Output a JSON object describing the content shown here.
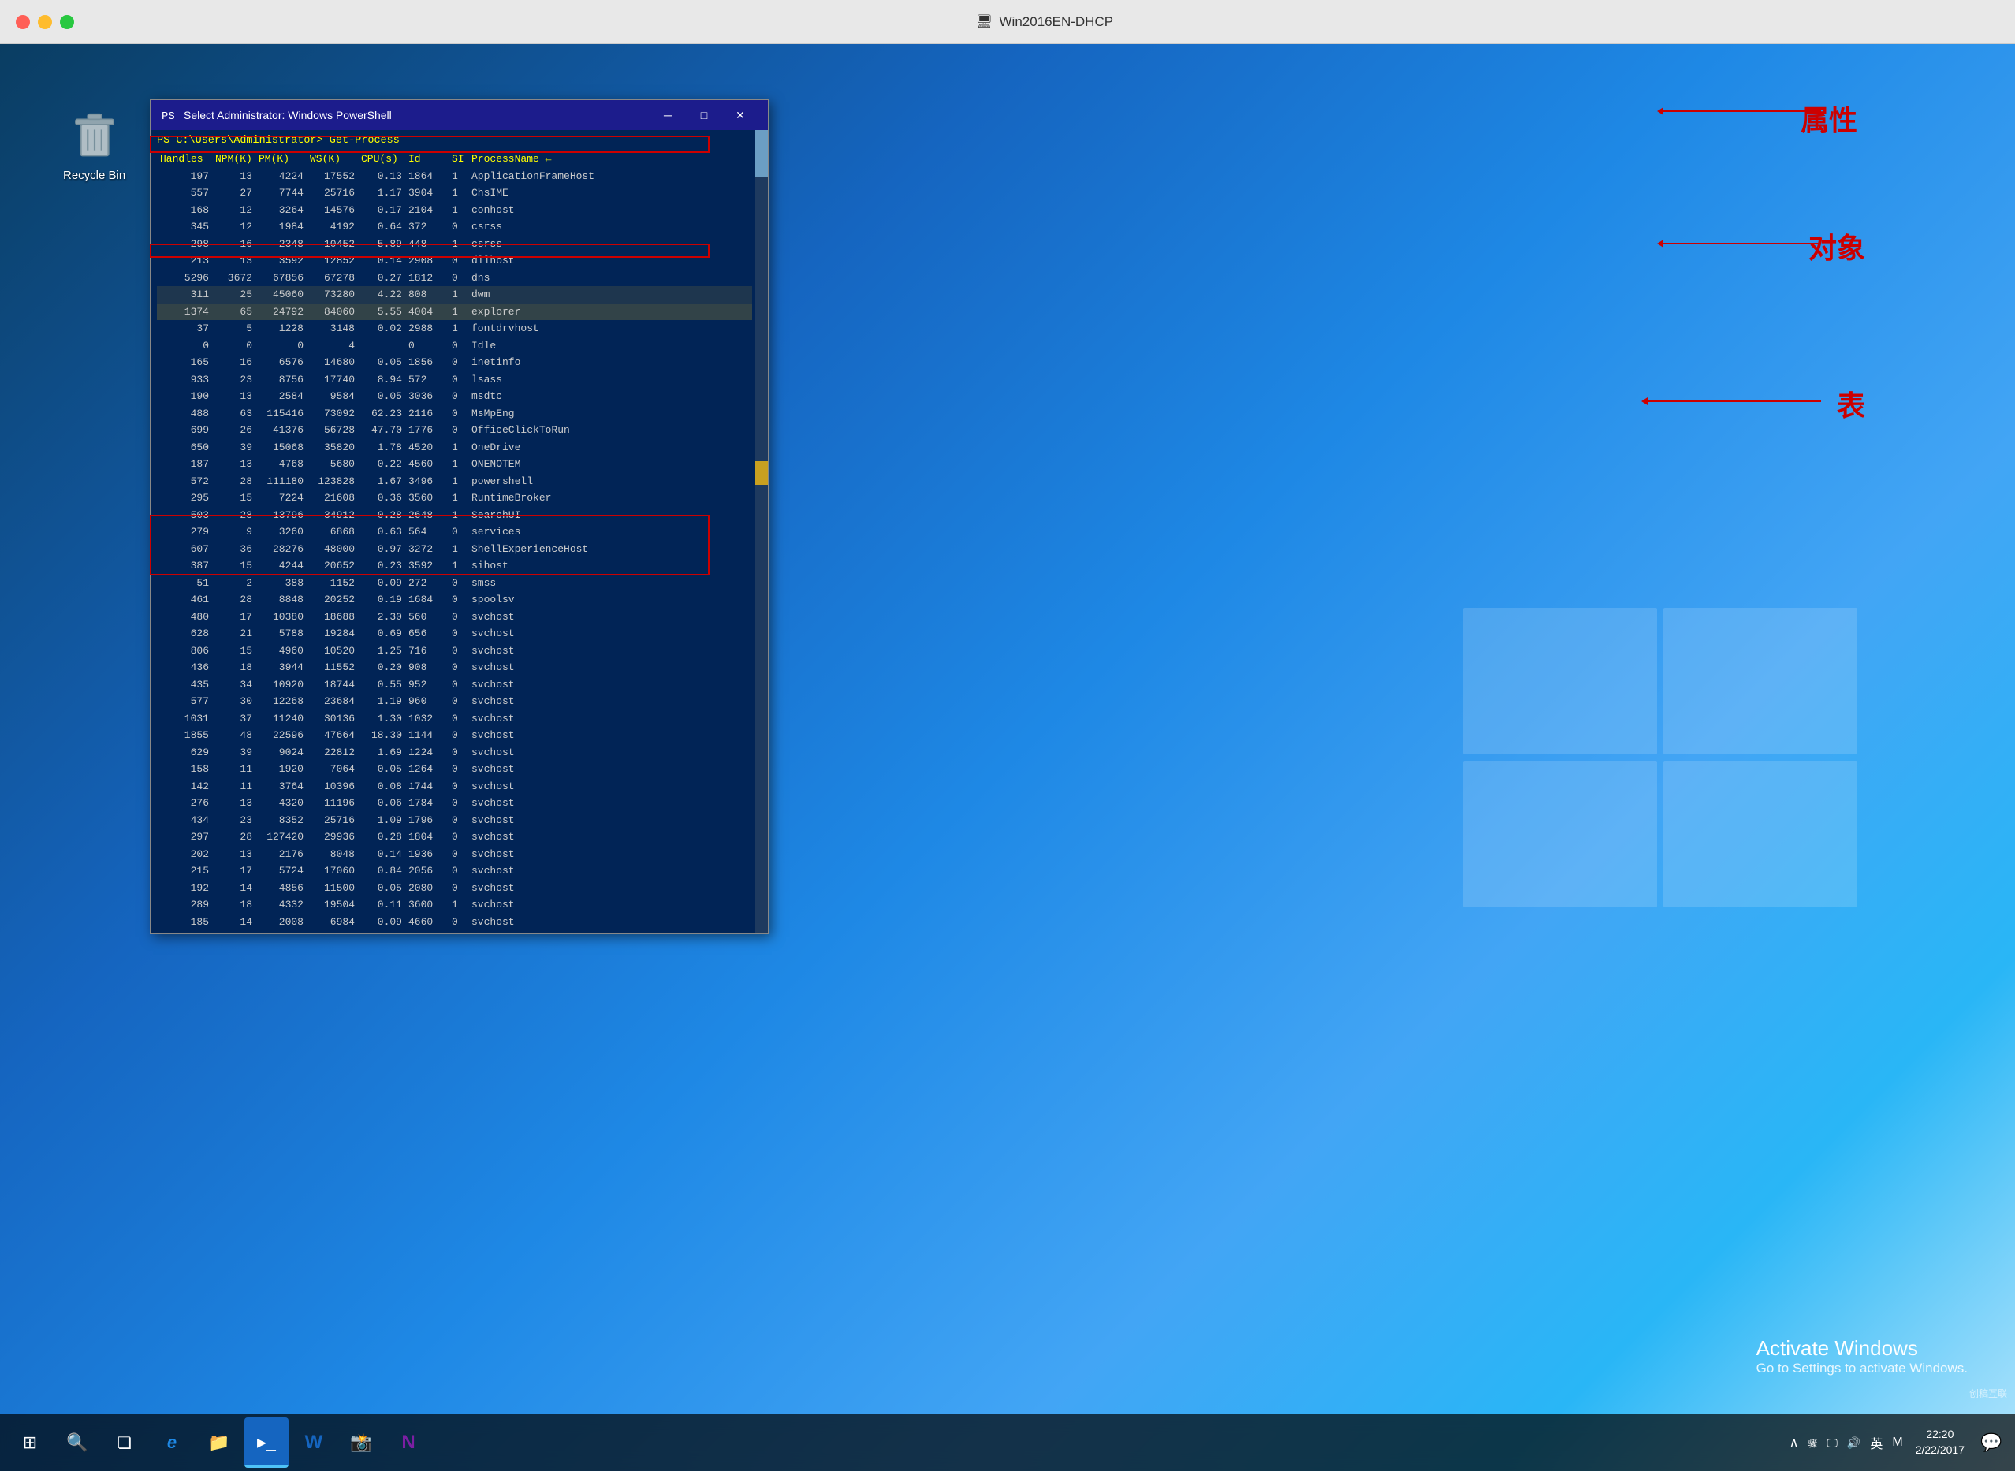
{
  "window": {
    "title": "Win2016EN-DHCP",
    "icon": "🖥"
  },
  "desktop": {
    "recycle_bin_label": "Recycle Bin"
  },
  "powershell": {
    "title": "Select Administrator: Windows PowerShell",
    "prompt": "PS C:\\Users\\Administrator> Get-Process",
    "columns": [
      "Handles",
      "NPM(K)",
      "PM(K)",
      "WS(K)",
      "CPU(s)",
      "Id",
      "SI",
      "ProcessName"
    ],
    "column_widths": [
      "70px",
      "55px",
      "70px",
      "70px",
      "60px",
      "55px",
      "30px",
      "150px"
    ],
    "processes": [
      [
        "197",
        "13",
        "4224",
        "17552",
        "0.13",
        "1864",
        "1",
        "ApplicationFrameHost"
      ],
      [
        "557",
        "27",
        "7744",
        "25716",
        "1.17",
        "3904",
        "1",
        "ChsIME"
      ],
      [
        "168",
        "12",
        "3264",
        "14576",
        "0.17",
        "2104",
        "1",
        "conhost"
      ],
      [
        "345",
        "12",
        "1984",
        "4192",
        "0.64",
        "372",
        "0",
        "csrss"
      ],
      [
        "298",
        "16",
        "2348",
        "10452",
        "5.89",
        "448",
        "1",
        "csrss"
      ],
      [
        "213",
        "13",
        "3592",
        "12852",
        "0.14",
        "2908",
        "0",
        "dllhost"
      ],
      [
        "5296",
        "3672",
        "67856",
        "67278",
        "0.27",
        "1812",
        "0",
        "dns"
      ],
      [
        "311",
        "25",
        "45060",
        "73280",
        "4.22",
        "808",
        "1",
        "dwm"
      ],
      [
        "1374",
        "65",
        "24792",
        "84060",
        "5.55",
        "4004",
        "1",
        "explorer"
      ],
      [
        "37",
        "5",
        "1228",
        "3148",
        "0.02",
        "2988",
        "1",
        "fontdrvhost"
      ],
      [
        "0",
        "0",
        "0",
        "4",
        "",
        "0",
        "0",
        "Idle"
      ],
      [
        "165",
        "16",
        "6576",
        "14680",
        "0.05",
        "1856",
        "0",
        "inetinfo"
      ],
      [
        "933",
        "23",
        "8756",
        "17740",
        "8.94",
        "572",
        "0",
        "lsass"
      ],
      [
        "190",
        "13",
        "2584",
        "9584",
        "0.05",
        "3036",
        "0",
        "msdtc"
      ],
      [
        "488",
        "63",
        "115416",
        "73092",
        "62.23",
        "2116",
        "0",
        "MsMpEng"
      ],
      [
        "699",
        "26",
        "41376",
        "56728",
        "47.70",
        "1776",
        "0",
        "OfficeClickToRun"
      ],
      [
        "650",
        "39",
        "15068",
        "35820",
        "1.78",
        "4520",
        "1",
        "OneDrive"
      ],
      [
        "187",
        "13",
        "4768",
        "5680",
        "0.22",
        "4560",
        "1",
        "ONENOTEM"
      ],
      [
        "572",
        "28",
        "111180",
        "123828",
        "1.67",
        "3496",
        "1",
        "powershell"
      ],
      [
        "295",
        "15",
        "7224",
        "21608",
        "0.36",
        "3560",
        "1",
        "RuntimeBroker"
      ],
      [
        "503",
        "28",
        "13796",
        "34912",
        "0.28",
        "2648",
        "1",
        "SearchUI"
      ],
      [
        "279",
        "9",
        "3260",
        "6868",
        "0.63",
        "564",
        "0",
        "services"
      ],
      [
        "607",
        "36",
        "28276",
        "48000",
        "0.97",
        "3272",
        "1",
        "ShellExperienceHost"
      ],
      [
        "387",
        "15",
        "4244",
        "20652",
        "0.23",
        "3592",
        "1",
        "sihost"
      ],
      [
        "51",
        "2",
        "388",
        "1152",
        "0.09",
        "272",
        "0",
        "smss"
      ],
      [
        "461",
        "28",
        "8848",
        "20252",
        "0.19",
        "1684",
        "0",
        "spoolsv"
      ],
      [
        "480",
        "17",
        "10380",
        "18688",
        "2.30",
        "560",
        "0",
        "svchost"
      ],
      [
        "628",
        "21",
        "5788",
        "19284",
        "0.69",
        "656",
        "0",
        "svchost"
      ],
      [
        "806",
        "15",
        "4960",
        "10520",
        "1.25",
        "716",
        "0",
        "svchost"
      ],
      [
        "436",
        "18",
        "3944",
        "11552",
        "0.20",
        "908",
        "0",
        "svchost"
      ],
      [
        "435",
        "34",
        "10920",
        "18744",
        "0.55",
        "952",
        "0",
        "svchost"
      ],
      [
        "577",
        "30",
        "12268",
        "23684",
        "1.19",
        "960",
        "0",
        "svchost"
      ],
      [
        "1031",
        "37",
        "11240",
        "30136",
        "1.30",
        "1032",
        "0",
        "svchost"
      ],
      [
        "1855",
        "48",
        "22596",
        "47664",
        "18.30",
        "1144",
        "0",
        "svchost"
      ],
      [
        "629",
        "39",
        "9024",
        "22812",
        "1.69",
        "1224",
        "0",
        "svchost"
      ],
      [
        "158",
        "11",
        "1920",
        "7064",
        "0.05",
        "1264",
        "0",
        "svchost"
      ],
      [
        "142",
        "11",
        "3764",
        "10396",
        "0.08",
        "1744",
        "0",
        "svchost"
      ],
      [
        "276",
        "13",
        "4320",
        "11196",
        "0.06",
        "1784",
        "0",
        "svchost"
      ],
      [
        "434",
        "23",
        "8352",
        "25716",
        "1.09",
        "1796",
        "0",
        "svchost"
      ],
      [
        "297",
        "28",
        "127420",
        "29936",
        "0.28",
        "1804",
        "0",
        "svchost"
      ],
      [
        "202",
        "13",
        "2176",
        "8048",
        "0.14",
        "1936",
        "0",
        "svchost"
      ],
      [
        "215",
        "17",
        "5724",
        "17060",
        "0.84",
        "2056",
        "0",
        "svchost"
      ],
      [
        "192",
        "14",
        "4856",
        "11500",
        "0.05",
        "2080",
        "0",
        "svchost"
      ],
      [
        "289",
        "18",
        "4332",
        "19504",
        "0.11",
        "3600",
        "1",
        "svchost"
      ],
      [
        "185",
        "14",
        "2008",
        "6984",
        "0.09",
        "4660",
        "0",
        "svchost"
      ]
    ],
    "highlighted_row_index": 8,
    "scrollbar_color": "#c8a020"
  },
  "annotations": {
    "label1": "属性",
    "label2": "对象",
    "label3": "表"
  },
  "taskbar": {
    "start_icon": "⊞",
    "search_icon": "🔍",
    "task_view_icon": "❏",
    "ie_icon": "e",
    "explorer_icon": "📁",
    "powershell_icon": "▶",
    "word_icon": "W",
    "snap_icon": "📸",
    "onenote_icon": "N",
    "clock": "22:20",
    "date": "2/22/2017",
    "lang": "英",
    "tray_arrow": "∧"
  },
  "activate_windows": {
    "title": "Activate Windows",
    "subtitle": "Go to Settings to activate Windows."
  },
  "corner_brand": "创稿互联"
}
